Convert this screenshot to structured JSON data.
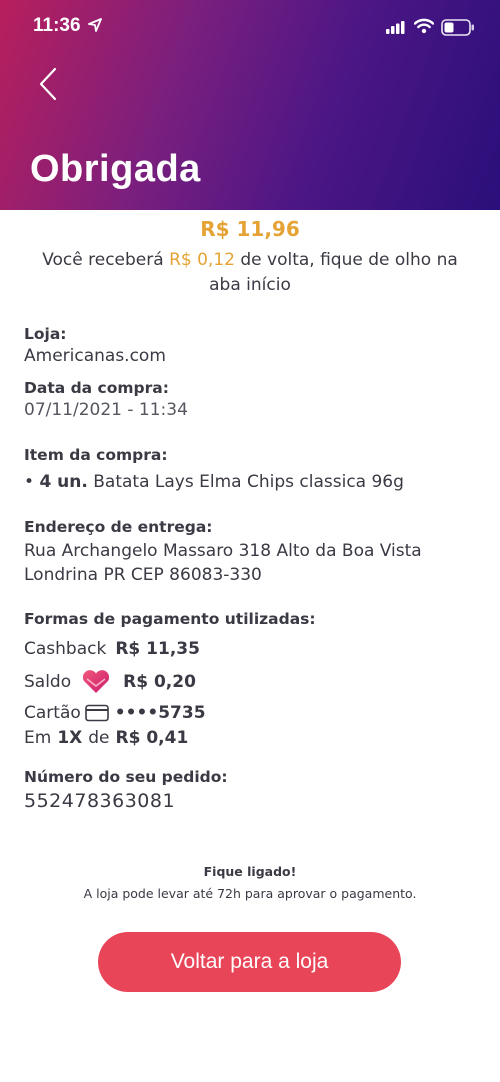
{
  "status_bar": {
    "time": "11:36"
  },
  "header": {
    "title": "Obrigada"
  },
  "summary": {
    "amount": "R$ 11,96",
    "cashback_prefix": "Você receberá",
    "cashback_value": "R$ 0,12",
    "cashback_suffix": "de volta, fique de olho na aba início"
  },
  "store": {
    "label": "Loja:",
    "value": "Americanas.com"
  },
  "purchase_date": {
    "label": "Data da compra:",
    "value": "07/11/2021 - 11:34"
  },
  "item": {
    "label": "Item da compra:",
    "bullet": "•",
    "quantity": "4 un.",
    "name": "Batata Lays Elma Chips classica 96g"
  },
  "address": {
    "label": "Endereço de entrega:",
    "line1": "Rua Archangelo Massaro  318  Alto da Boa Vista",
    "line2": "Londrina  PR CEP 86083-330"
  },
  "payment": {
    "label": "Formas de pagamento utilizadas:",
    "cashback_label": "Cashback",
    "cashback_value": "R$ 11,35",
    "balance_label": "Saldo",
    "balance_value": "R$ 0,20",
    "card_label": "Cartão",
    "card_number": "••••5735",
    "installments_prefix": "Em",
    "installments_count": "1X",
    "installments_mid": "de",
    "installments_value": "R$ 0,41"
  },
  "order": {
    "label": "Número do seu pedido:",
    "number": "552478363081"
  },
  "notice": {
    "title": "Fique ligado!",
    "text": "A loja pode levar até 72h para aprovar o pagamento."
  },
  "cta": {
    "label": "Voltar para a loja"
  },
  "colors": {
    "accent": "#e5a335",
    "button": "#e94558",
    "header_start": "#b81f5c",
    "header_end": "#2a0f7a"
  }
}
